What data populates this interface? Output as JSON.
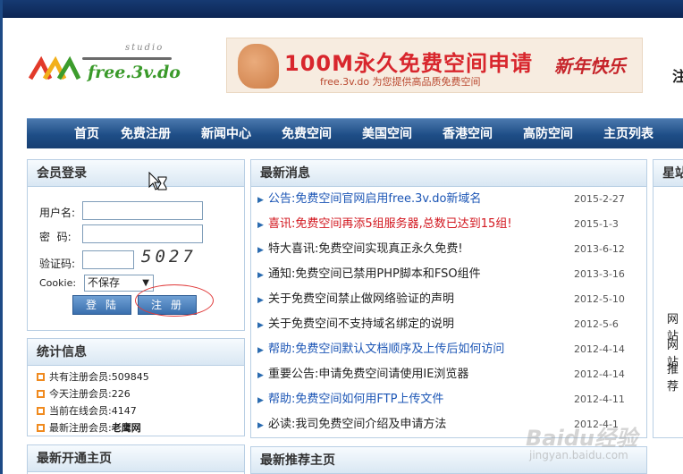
{
  "logo": {
    "studio": "studio",
    "domain": "free.3v.do"
  },
  "banner": {
    "headline": "100M永久免费空间申请",
    "sub": "free.3v.do 为您提供高品质免费空间",
    "greeting": "新年快乐"
  },
  "header_right_char": "注",
  "nav": [
    "首页",
    "免费注册",
    "新闻中心",
    "免费空间",
    "美国空间",
    "香港空间",
    "高防空间",
    "主页列表"
  ],
  "login": {
    "title": "会员登录",
    "username_label": "用户名:",
    "password_label": "密  码:",
    "captcha_label": "验证码:",
    "captcha_value": "5027",
    "cookie_label": "Cookie:",
    "cookie_selected": "不保存",
    "login_button": "登陆",
    "register_button": "注册"
  },
  "stats": {
    "title": "统计信息",
    "items": [
      {
        "label": "共有注册会员:",
        "value": "509845"
      },
      {
        "label": "今天注册会员:",
        "value": "226"
      },
      {
        "label": "当前在线会员:",
        "value": "4147"
      },
      {
        "label": "最新注册会员:",
        "value": "老鹰网"
      }
    ]
  },
  "latest_sites": {
    "title": "最新开通主页"
  },
  "news": {
    "title": "最新消息",
    "items": [
      {
        "text": "公告:免费空间官网启用free.3v.do新域名",
        "date": "2015-2-27",
        "color": "#1b55b5"
      },
      {
        "text": "喜讯:免费空间再添5组服务器,总数已达到15组!",
        "date": "2015-1-3",
        "color": "#d2161e"
      },
      {
        "text": "特大喜讯:免费空间实现真正永久免费!",
        "date": "2013-6-12",
        "color": "#222222"
      },
      {
        "text": "通知:免费空间已禁用PHP脚本和FSO组件",
        "date": "2013-3-16",
        "color": "#222222"
      },
      {
        "text": "关于免费空间禁止做网络验证的声明",
        "date": "2012-5-10",
        "color": "#222222"
      },
      {
        "text": "关于免费空间不支持域名绑定的说明",
        "date": "2012-5-6",
        "color": "#222222"
      },
      {
        "text": "帮助:免费空间默认文档顺序及上传后如何访问",
        "date": "2012-4-14",
        "color": "#1b55b5"
      },
      {
        "text": "重要公告:申请免费空间请使用IE浏览器",
        "date": "2012-4-14",
        "color": "#222222"
      },
      {
        "text": "帮助:免费空间如何用FTP上传文件",
        "date": "2012-4-11",
        "color": "#1b55b5"
      },
      {
        "text": "必读:我司免费空间介绍及申请方法",
        "date": "2012-4-1",
        "color": "#222222"
      }
    ]
  },
  "recommended": {
    "title": "最新推荐主页"
  },
  "right_panel": {
    "title": "星站",
    "lines": [
      "网站",
      "网站",
      "推荐"
    ]
  },
  "watermark": {
    "main": "Baidu经验",
    "sub": "jingyan.baidu.com"
  }
}
